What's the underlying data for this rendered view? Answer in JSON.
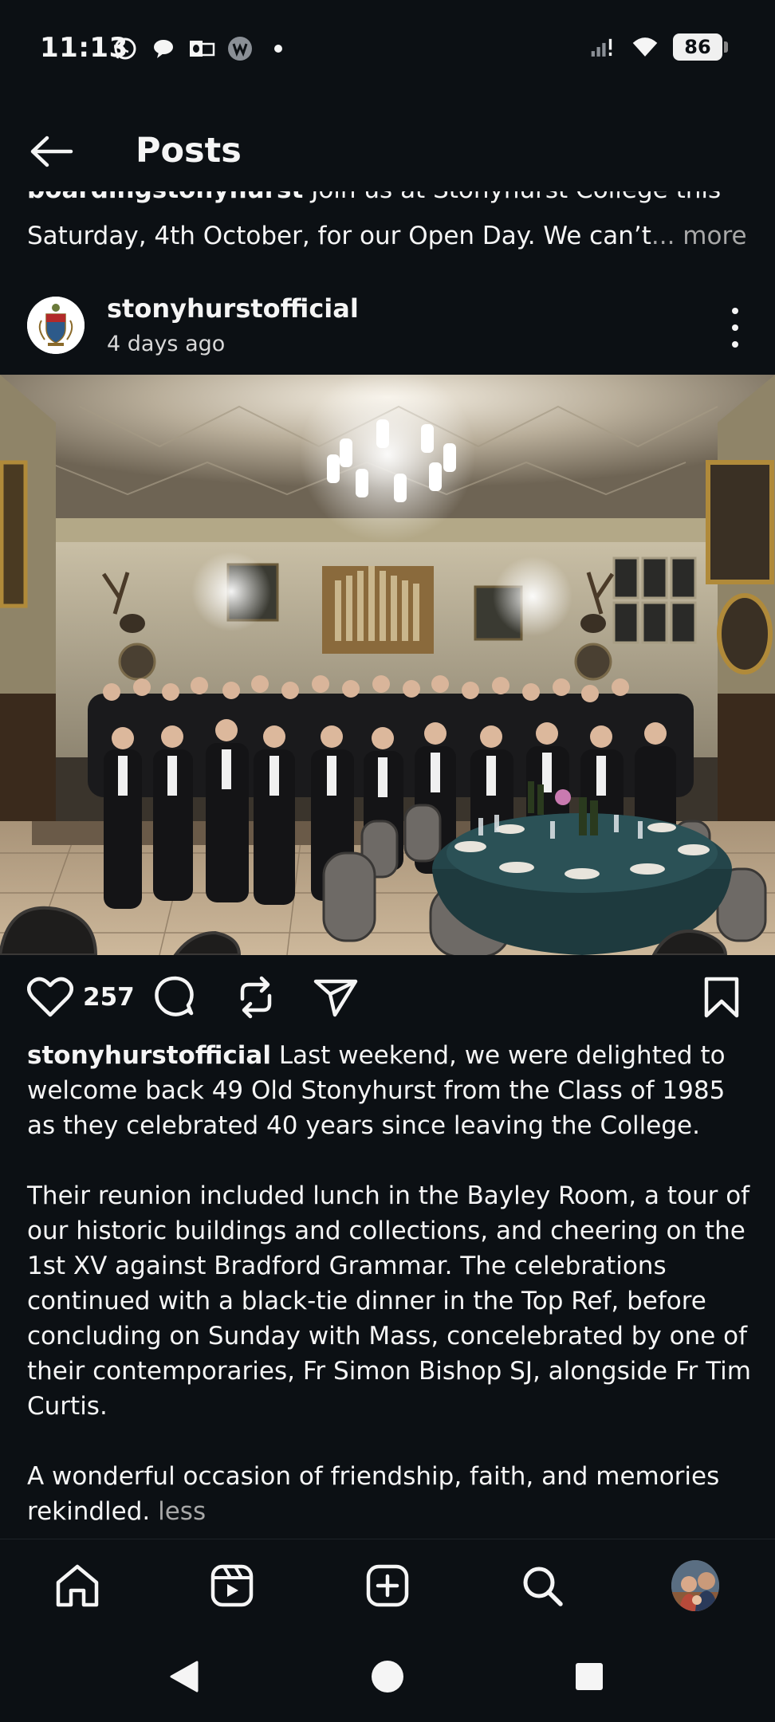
{
  "status_bar": {
    "time": "11:13",
    "battery": "86",
    "left_icons": [
      "whatsapp-icon",
      "chat-bubble-icon",
      "outlook-icon",
      "w-app-icon",
      "dot-icon"
    ],
    "right_icons": [
      "signal-icon",
      "wifi-icon",
      "battery-icon"
    ]
  },
  "header": {
    "title": "Posts",
    "back_icon": "arrow-left-icon"
  },
  "previous_post": {
    "username": "boardingstonyhurst",
    "caption_line1": "Join us at Stonyhurst College this",
    "caption_line2": "Saturday, 4th October, for our Open Day. We can’t",
    "ellipsis": "...",
    "more_label": "more"
  },
  "post": {
    "username": "stonyhurstofficial",
    "time_ago": "4 days ago",
    "likes": "257",
    "caption_username": "stonyhurstofficial",
    "caption_paragraphs": [
      "Last weekend, we were delighted to welcome back 49 Old Stonyhurst from the Class of 1985 as they celebrated 40 years since leaving the College.",
      "Their reunion included lunch in the Bayley Room, a tour of our historic buildings and collections, and cheering on the 1st XV against Bradford Grammar. The celebrations continued with a black-tie dinner in the Top Ref, before concluding on Sunday with Mass, concelebrated by one of their contemporaries, Fr Simon Bishop SJ, alongside Fr Tim Curtis.",
      "A wonderful occasion of friendship, faith, and memories rekindled."
    ],
    "less_label": "less"
  },
  "colors": {
    "background": "#0c1014",
    "text": "#f5f5f5",
    "muted": "#a8a8a8"
  },
  "bottom_nav": [
    "home-icon",
    "reels-icon",
    "create-icon",
    "search-icon",
    "profile-avatar"
  ],
  "system_nav": [
    "back-triangle-icon",
    "home-circle-icon",
    "recents-square-icon"
  ]
}
